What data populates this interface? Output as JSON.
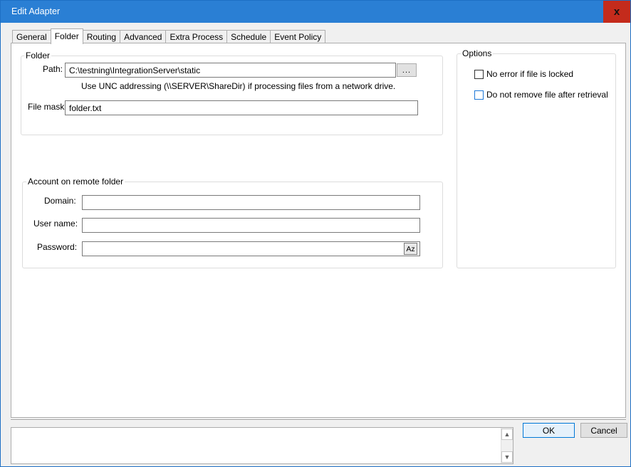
{
  "window": {
    "title": "Edit Adapter",
    "close_label": "x"
  },
  "tabs": [
    {
      "label": "General"
    },
    {
      "label": "Folder",
      "active": true
    },
    {
      "label": "Routing"
    },
    {
      "label": "Advanced"
    },
    {
      "label": "Extra Process"
    },
    {
      "label": "Schedule"
    },
    {
      "label": "Event Policy"
    }
  ],
  "folder_group": {
    "legend": "Folder",
    "path_label": "Path:",
    "path_value": "C:\\testning\\IntegrationServer\\static",
    "browse_label": "...",
    "unc_hint": "Use UNC addressing (\\\\SERVER\\ShareDir) if processing files from a network drive.",
    "file_mask_label": "File mask:",
    "file_mask_value": "folder.txt"
  },
  "account_group": {
    "legend": "Account on remote folder",
    "domain_label": "Domain:",
    "domain_value": "",
    "username_label": "User name:",
    "username_value": "",
    "password_label": "Password:",
    "password_value": "",
    "reveal_label": "Az"
  },
  "options_group": {
    "legend": "Options",
    "no_error_locked_label": "No error if file is locked",
    "no_error_locked_checked": false,
    "do_not_remove_label": "Do not remove file after retrieval",
    "do_not_remove_checked": false
  },
  "scroll": {
    "up_icon": "chevron-up-icon",
    "down_icon": "chevron-down-icon"
  },
  "buttons": {
    "ok_label": "OK",
    "cancel_label": "Cancel"
  }
}
